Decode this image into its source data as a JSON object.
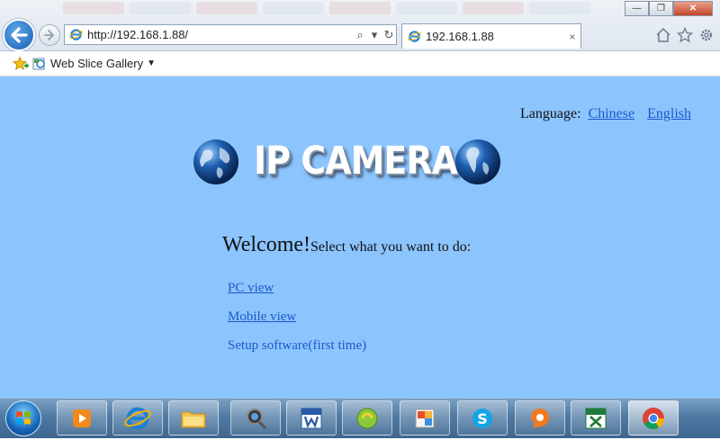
{
  "browser": {
    "address_url": "http://192.168.1.88/",
    "tab_title": "192.168.1.88",
    "tab_close": "×",
    "window_controls": {
      "minimize": "—",
      "restore": "❐",
      "close": "✕"
    },
    "address_tools": {
      "search": "⌕",
      "dropdown": "▾",
      "refresh": "↻"
    }
  },
  "favorites_bar": {
    "web_slice_gallery": "Web Slice Gallery",
    "dropdown_arrow": "▼"
  },
  "page": {
    "language_label": "Language:",
    "languages": [
      "Chinese",
      "English"
    ],
    "brand_title": "IP CAMERA",
    "welcome": "Welcome!",
    "welcome_prompt": "Select what you want to do:",
    "links": {
      "pc_view": "PC view",
      "mobile_view": "Mobile view",
      "setup_software": "Setup software(first time)"
    }
  },
  "colors": {
    "page_background": "#8cc5fe",
    "link": "#1c57c9",
    "taskbar": "#4f7aa3"
  },
  "taskbar": {
    "icons": [
      "windows-media-player-icon",
      "internet-explorer-icon",
      "file-explorer-icon",
      "camera-search-icon",
      "microsoft-word-icon",
      "green-app-icon",
      "image-tool-icon",
      "skype-icon",
      "orange-app-icon",
      "microsoft-excel-icon",
      "google-chrome-icon"
    ]
  }
}
